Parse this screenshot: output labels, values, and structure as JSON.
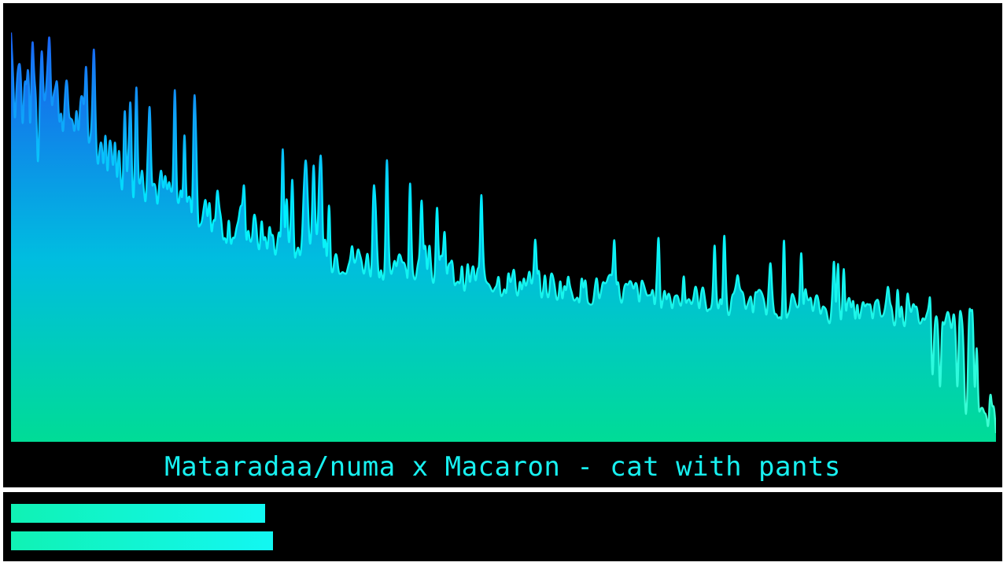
{
  "title": "Mataradaa/numa x Macaron - cat with pants",
  "spectrum": {
    "bins": 512,
    "seed": 7,
    "colors": {
      "top": "#1a5cf0",
      "mid": "#00e0ff",
      "bottom": "#00dc96",
      "stroke_top": "#1a60f4",
      "stroke_mid": "#00f0ff",
      "stroke_bottom": "#40ffcf",
      "background": "#000000"
    }
  },
  "levels": {
    "left": 0.254,
    "right": 0.262,
    "colors": {
      "start": "#10f2b4",
      "end": "#12f7f2"
    }
  }
}
